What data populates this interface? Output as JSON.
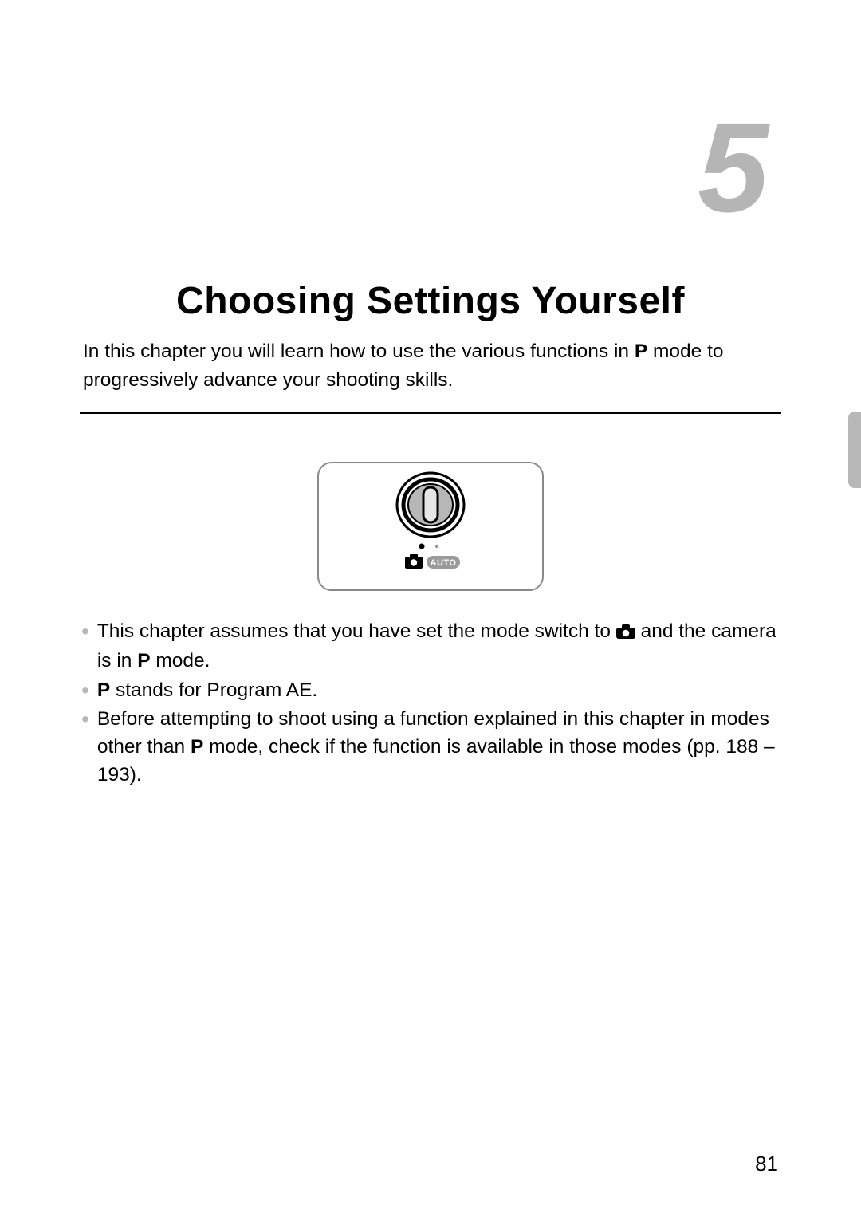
{
  "chapter": {
    "number": "5",
    "title": "Choosing Settings Yourself",
    "intro_before_p": "In this chapter you will learn how to use the various functions in ",
    "intro_p": "P",
    "intro_after_p": " mode to progressively advance your shooting skills."
  },
  "bullets": {
    "b1_pre": "This chapter assumes that you have set the mode switch to ",
    "b1_post": " and the camera is in ",
    "b1_p": "P",
    "b1_end": " mode.",
    "b2_p": "P",
    "b2_text": " stands for Program AE.",
    "b3_pre": "Before attempting to shoot using a function explained in this chapter in modes other than ",
    "b3_p": "P",
    "b3_post": " mode, check if the function is available in those modes (pp. 188 – 193)."
  },
  "diagram": {
    "auto_label": "AUTO"
  },
  "page_number": "81"
}
